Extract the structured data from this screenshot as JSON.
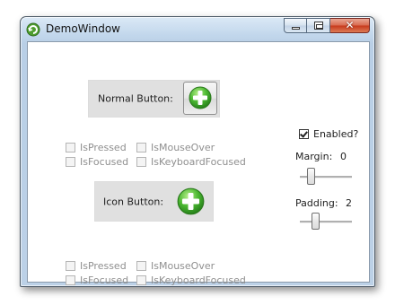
{
  "window": {
    "title": "DemoWindow",
    "controls": {
      "minimize": "minimize",
      "maximize": "maximize",
      "close": "close"
    }
  },
  "normal_button": {
    "label": "Normal Button:",
    "icon": "plus-circle-icon",
    "states": {
      "is_pressed": "IsPressed",
      "is_mouse_over": "IsMouseOver",
      "is_focused": "IsFocused",
      "is_keyboard_focused": "IsKeyboardFocused"
    }
  },
  "icon_button": {
    "label": "Icon Button:",
    "icon": "plus-circle-icon",
    "states": {
      "is_pressed": "IsPressed",
      "is_mouse_over": "IsMouseOver",
      "is_focused": "IsFocused",
      "is_keyboard_focused": "IsKeyboardFocused"
    }
  },
  "settings": {
    "enabled_label": "Enabled?",
    "enabled_checked": true,
    "margin_label": "Margin:",
    "margin_value": "0",
    "padding_label": "Padding:",
    "padding_value": "2"
  },
  "colors": {
    "plus_green": "#3aa82a",
    "close_red": "#c7381c",
    "button_bg": "#e0e0e0"
  }
}
